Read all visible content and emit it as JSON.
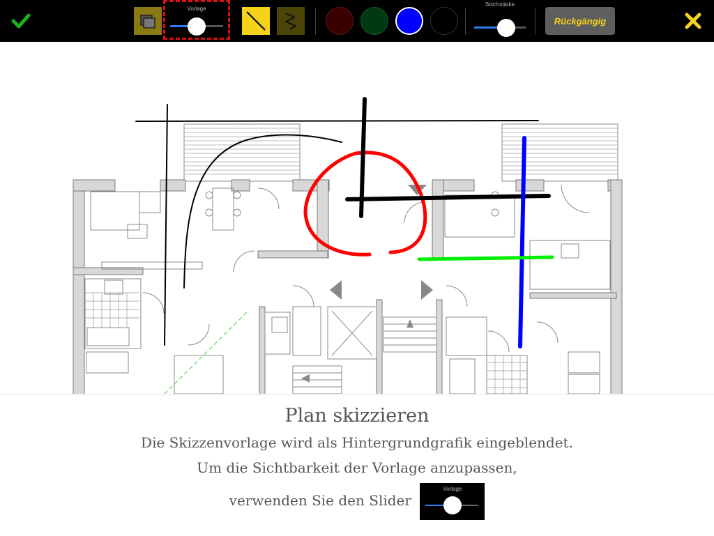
{
  "toolbar": {
    "confirm_icon": "checkmark-icon",
    "template_slider": {
      "label": "Vorlage",
      "value": 0.5
    },
    "stroke_slider": {
      "label": "Strichstärke",
      "value": 0.6
    },
    "colors": [
      "#3a0000",
      "#003a10",
      "#0000ff",
      "#000000"
    ],
    "selected_color": "#0000ff",
    "undo_label": "Rückgängig",
    "close_icon": "close-x-icon",
    "accent_color": "#f6d21a"
  },
  "tip": {
    "title": "Plan skizzieren",
    "line1": "Die Skizzenvorlage wird als Hintergrundgrafik eingeblendet.",
    "line2": "Um die Sichtbarkeit der Vorlage anzupassen,",
    "line3": "verwenden Sie den Slider",
    "slider_label": "Vorlage"
  }
}
